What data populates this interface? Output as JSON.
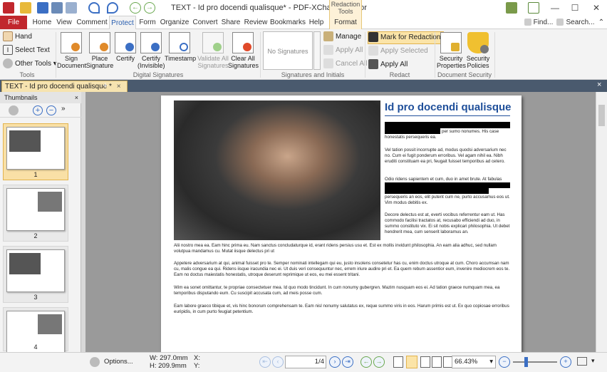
{
  "title": "TEXT - Id pro docendi qualisque* - PDF-XChange Editor",
  "context_tab_group": "Redaction Tools",
  "window_buttons": [
    "—",
    "☐",
    "✕"
  ],
  "tabs": [
    "File",
    "Home",
    "View",
    "Comment",
    "Protect",
    "Form",
    "Organize",
    "Convert",
    "Share",
    "Review",
    "Bookmarks",
    "Help",
    "Format"
  ],
  "active_tab": "Protect",
  "right_tools": {
    "find": "Find...",
    "search": "Search..."
  },
  "ribbon": {
    "tools": {
      "hand": "Hand",
      "select_text": "Select Text",
      "other_tools": "Other Tools",
      "label": "Tools"
    },
    "digital_signatures": {
      "sign_document": "Sign Document",
      "place_signature": "Place Signature",
      "certify": "Certify",
      "certify_invisible": "Certify (Invisible)",
      "timestamp": "Timestamp",
      "validate_all": "Validate All Signatures",
      "clear_all": "Clear All Signatures",
      "label": "Digital Signatures"
    },
    "signatures_initials": {
      "no_signatures": "No Signatures",
      "manage": "Manage",
      "apply_all": "Apply All",
      "cancel_all": "Cancel All",
      "label": "Signatures and Initials"
    },
    "redact": {
      "mark": "Mark for Redaction",
      "apply_selected": "Apply Selected",
      "apply_all": "Apply All",
      "label": "Redact"
    },
    "document_security": {
      "properties": "Security Properties",
      "policies": "Security Policies",
      "label": "Document Security"
    }
  },
  "doc_tab": "TEXT - Id pro docendi qualisque *",
  "thumbnails": {
    "title": "Thumbnails",
    "pages": [
      "1",
      "2",
      "3",
      "4"
    ]
  },
  "document": {
    "heading": "Id pro docendi qualisque",
    "right_paragraphs": [
      "per sumo nonumes. His case honestatis persequeris ea.",
      "Vel tation possit incorrupte ad, modus quodsi adversarium nec no. Cum ei fugit ponderum erroribus. Vel agam nihil ea. Nibh eruditi constituam ea pri, feugait fuisset temporibus ad cetero.",
      "Odio ridens sapientem et cum, duo in amet brute. At fabulas",
      "persequeris an eos, elit putent cum ne, purto accusamus eos ut. Vim modus debitis ex.",
      "Decore delectus est at, everti vocibus referrentur eam ut. Has commodo facilisi tractatos at, recusabo efficiendi ad duo, in summo constituto vix. Ei sit nobis explicari philosophia. Ut debet hendrerit mea, cum senserit laboramus an."
    ],
    "body_paragraphs": [
      "Alii nostro mea ea. Eam hinc prima eu. Nam sanctus concludaturque id, erant ridens persius usu et. Est ex mollis invidunt philosophia. An eam alia adhuc, sed nullam volutpua mandamus cu. Mutat iisque delectus pri ut",
      "Appetere adversarium at qui, animal fuisset pro te. Semper nominati intellegam qui eu, justo insolens consetetur has cu, enim doctus utroque at cum. Choro accumsan nam cu, malis congue ea qui. Ridens iisque iracundia nec ei. Ut duis veri consequuntur nec, errem iriure audire pri et. Ea quem rebum assentior eum, invenire mediocrem eos te. Eam no doctus maiestatis honestatis, utroque deserunt reprimique ut eos, eu mei essent tritani.",
      "Wim ea sonet omittantur, te propriae consectetuer mea. Id quo modo tincidunt. In cum nonumy gubergren. Mazim nusquam eos ei. Ad tation graece numquam mea, ea temporibus disputando eum. Cu suscipit accusata cum, ad meis posse cum.",
      "Eam labore graeco tibique et, vis hinc bonorum comprehensam te. Eam nisl nonumy salutatus ex, reque summo viris in eos. Harum primis est ut. Ex quo copiosae erroribus euripidis, in cum purto feugiat petentium."
    ]
  },
  "status": {
    "options": "Options...",
    "width": "W: 297.0mm",
    "height": "H: 209.9mm",
    "x": "X:",
    "y": "Y:",
    "page": "1",
    "page_total": "/4",
    "zoom": "66.43%"
  }
}
